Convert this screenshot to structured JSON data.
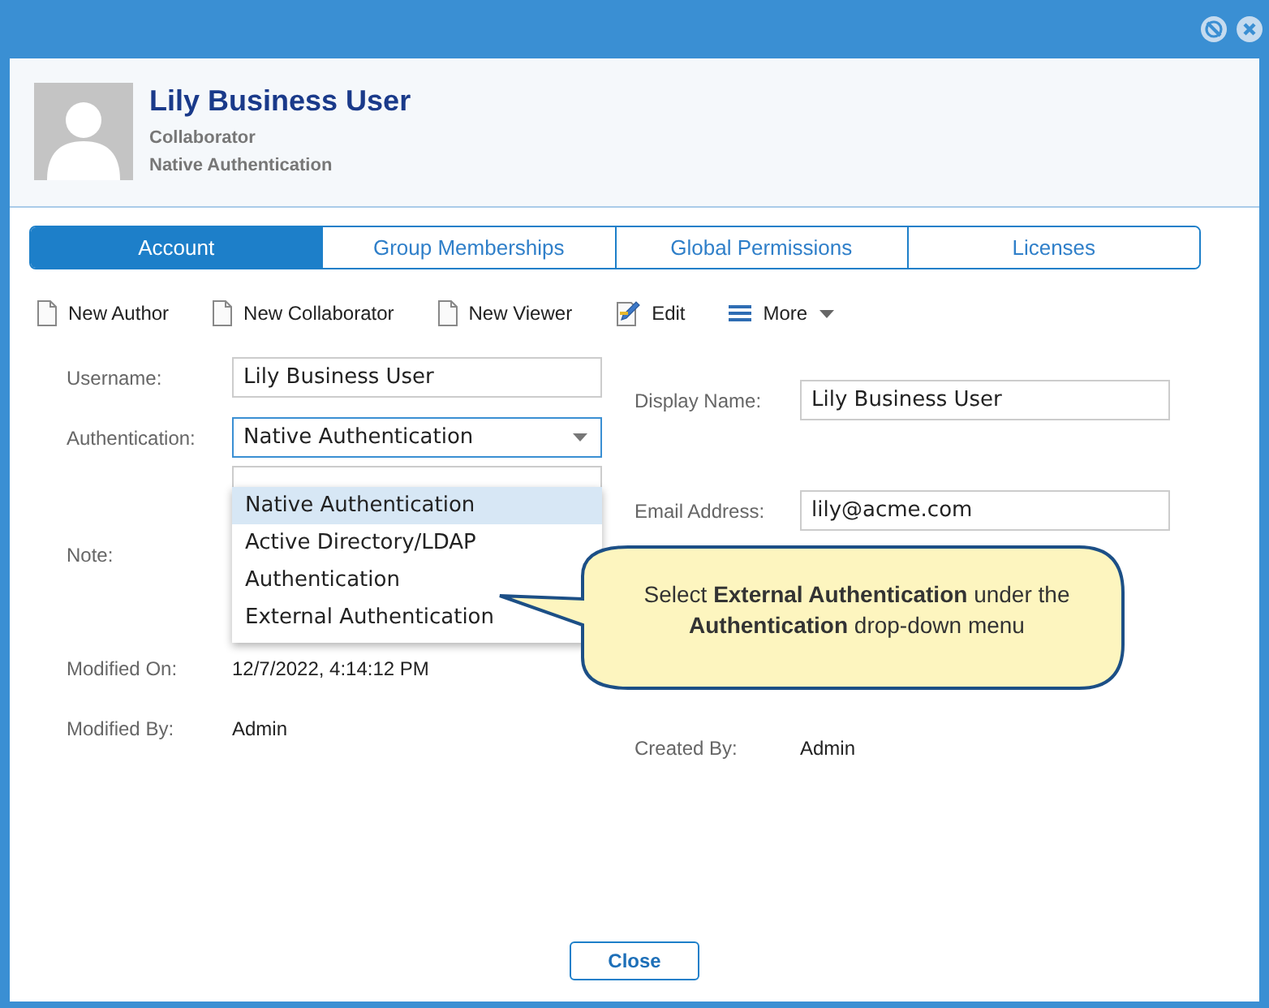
{
  "user": {
    "name": "Lily Business User",
    "role": "Collaborator",
    "auth": "Native Authentication"
  },
  "tabs": [
    {
      "label": "Account",
      "selected": true
    },
    {
      "label": "Group Memberships",
      "selected": false
    },
    {
      "label": "Global Permissions",
      "selected": false
    },
    {
      "label": "Licenses",
      "selected": false
    }
  ],
  "toolbar": [
    {
      "label": "New Author",
      "kind": "page"
    },
    {
      "label": "New Collaborator",
      "kind": "page"
    },
    {
      "label": "New Viewer",
      "kind": "page"
    },
    {
      "label": "Edit",
      "kind": "edit"
    },
    {
      "label": "More",
      "kind": "menu"
    }
  ],
  "form": {
    "username": {
      "label": "Username:",
      "value": "Lily Business User"
    },
    "authentication": {
      "label": "Authentication:",
      "value": "Native Authentication",
      "options": [
        {
          "label": "Native Authentication",
          "selected": true
        },
        {
          "label": "Active Directory/LDAP",
          "selected": false
        },
        {
          "label": "Authentication",
          "selected": false
        },
        {
          "label": "External Authentication",
          "selected": false
        }
      ]
    },
    "note": {
      "label": "Note:"
    },
    "modified_on": {
      "label": "Modified On:",
      "value": "12/7/2022, 4:14:12 PM"
    },
    "modified_by": {
      "label": "Modified By:",
      "value": "Admin"
    },
    "display_name": {
      "label": "Display Name:",
      "value": "Lily Business User"
    },
    "email": {
      "label": "Email Address:",
      "value": "lily@acme.com"
    },
    "created_by": {
      "label": "Created By:",
      "value": "Admin"
    }
  },
  "callout": "Select **External Authentication** under the **Authentication** drop-down menu",
  "buttons": [
    "Close"
  ]
}
